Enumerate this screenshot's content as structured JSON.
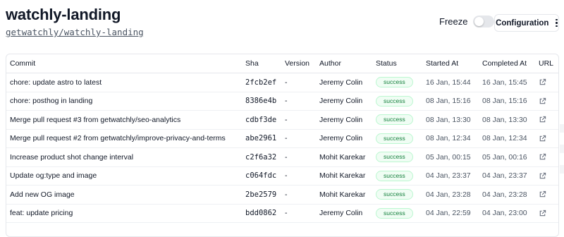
{
  "page": {
    "title": "watchly-landing",
    "repo_link": "getwatchly/watchly-landing"
  },
  "controls": {
    "freeze_label": "Freeze",
    "freeze_on": false,
    "configuration_label": "Configuration"
  },
  "table": {
    "headers": {
      "commit": "Commit",
      "sha": "Sha",
      "version": "Version",
      "author": "Author",
      "status": "Status",
      "started": "Started At",
      "completed": "Completed At",
      "url": "URL"
    },
    "rows": [
      {
        "commit": "chore: update astro to latest",
        "sha": "2fcb2ef",
        "version": "-",
        "author": "Jeremy Colin",
        "status": "success",
        "started": "16 Jan, 15:44",
        "completed": "16 Jan, 15:45"
      },
      {
        "commit": "chore: posthog in landing",
        "sha": "8386e4b",
        "version": "-",
        "author": "Jeremy Colin",
        "status": "success",
        "started": "08 Jan, 15:16",
        "completed": "08 Jan, 15:16"
      },
      {
        "commit": "Merge pull request #3 from getwatchly/seo-analytics",
        "sha": "cdbf3de",
        "version": "-",
        "author": "Jeremy Colin",
        "status": "success",
        "started": "08 Jan, 13:30",
        "completed": "08 Jan, 13:30"
      },
      {
        "commit": "Merge pull request #2 from getwatchly/improve-privacy-and-terms",
        "sha": "abe2961",
        "version": "-",
        "author": "Jeremy Colin",
        "status": "success",
        "started": "08 Jan, 12:34",
        "completed": "08 Jan, 12:34"
      },
      {
        "commit": "Increase product shot change interval",
        "sha": "c2f6a32",
        "version": "-",
        "author": "Mohit Karekar",
        "status": "success",
        "started": "05 Jan, 00:15",
        "completed": "05 Jan, 00:16"
      },
      {
        "commit": "Update og:type and image",
        "sha": "c064fdc",
        "version": "-",
        "author": "Mohit Karekar",
        "status": "success",
        "started": "04 Jan, 23:37",
        "completed": "04 Jan, 23:37"
      },
      {
        "commit": "Add new OG image",
        "sha": "2be2579",
        "version": "-",
        "author": "Mohit Karekar",
        "status": "success",
        "started": "04 Jan, 23:28",
        "completed": "04 Jan, 23:28"
      },
      {
        "commit": "feat: update pricing",
        "sha": "bdd0862",
        "version": "-",
        "author": "Jeremy Colin",
        "status": "success",
        "started": "04 Jan, 22:59",
        "completed": "04 Jan, 23:00"
      },
      {
        "commit": "",
        "sha": "",
        "version": "",
        "author": "",
        "status": "",
        "started": "",
        "completed": ""
      }
    ],
    "url_icon": "external-link-icon"
  },
  "colors": {
    "success_text": "#15803d",
    "success_bg": "#f0fdf4",
    "border": "#e5e7eb"
  }
}
